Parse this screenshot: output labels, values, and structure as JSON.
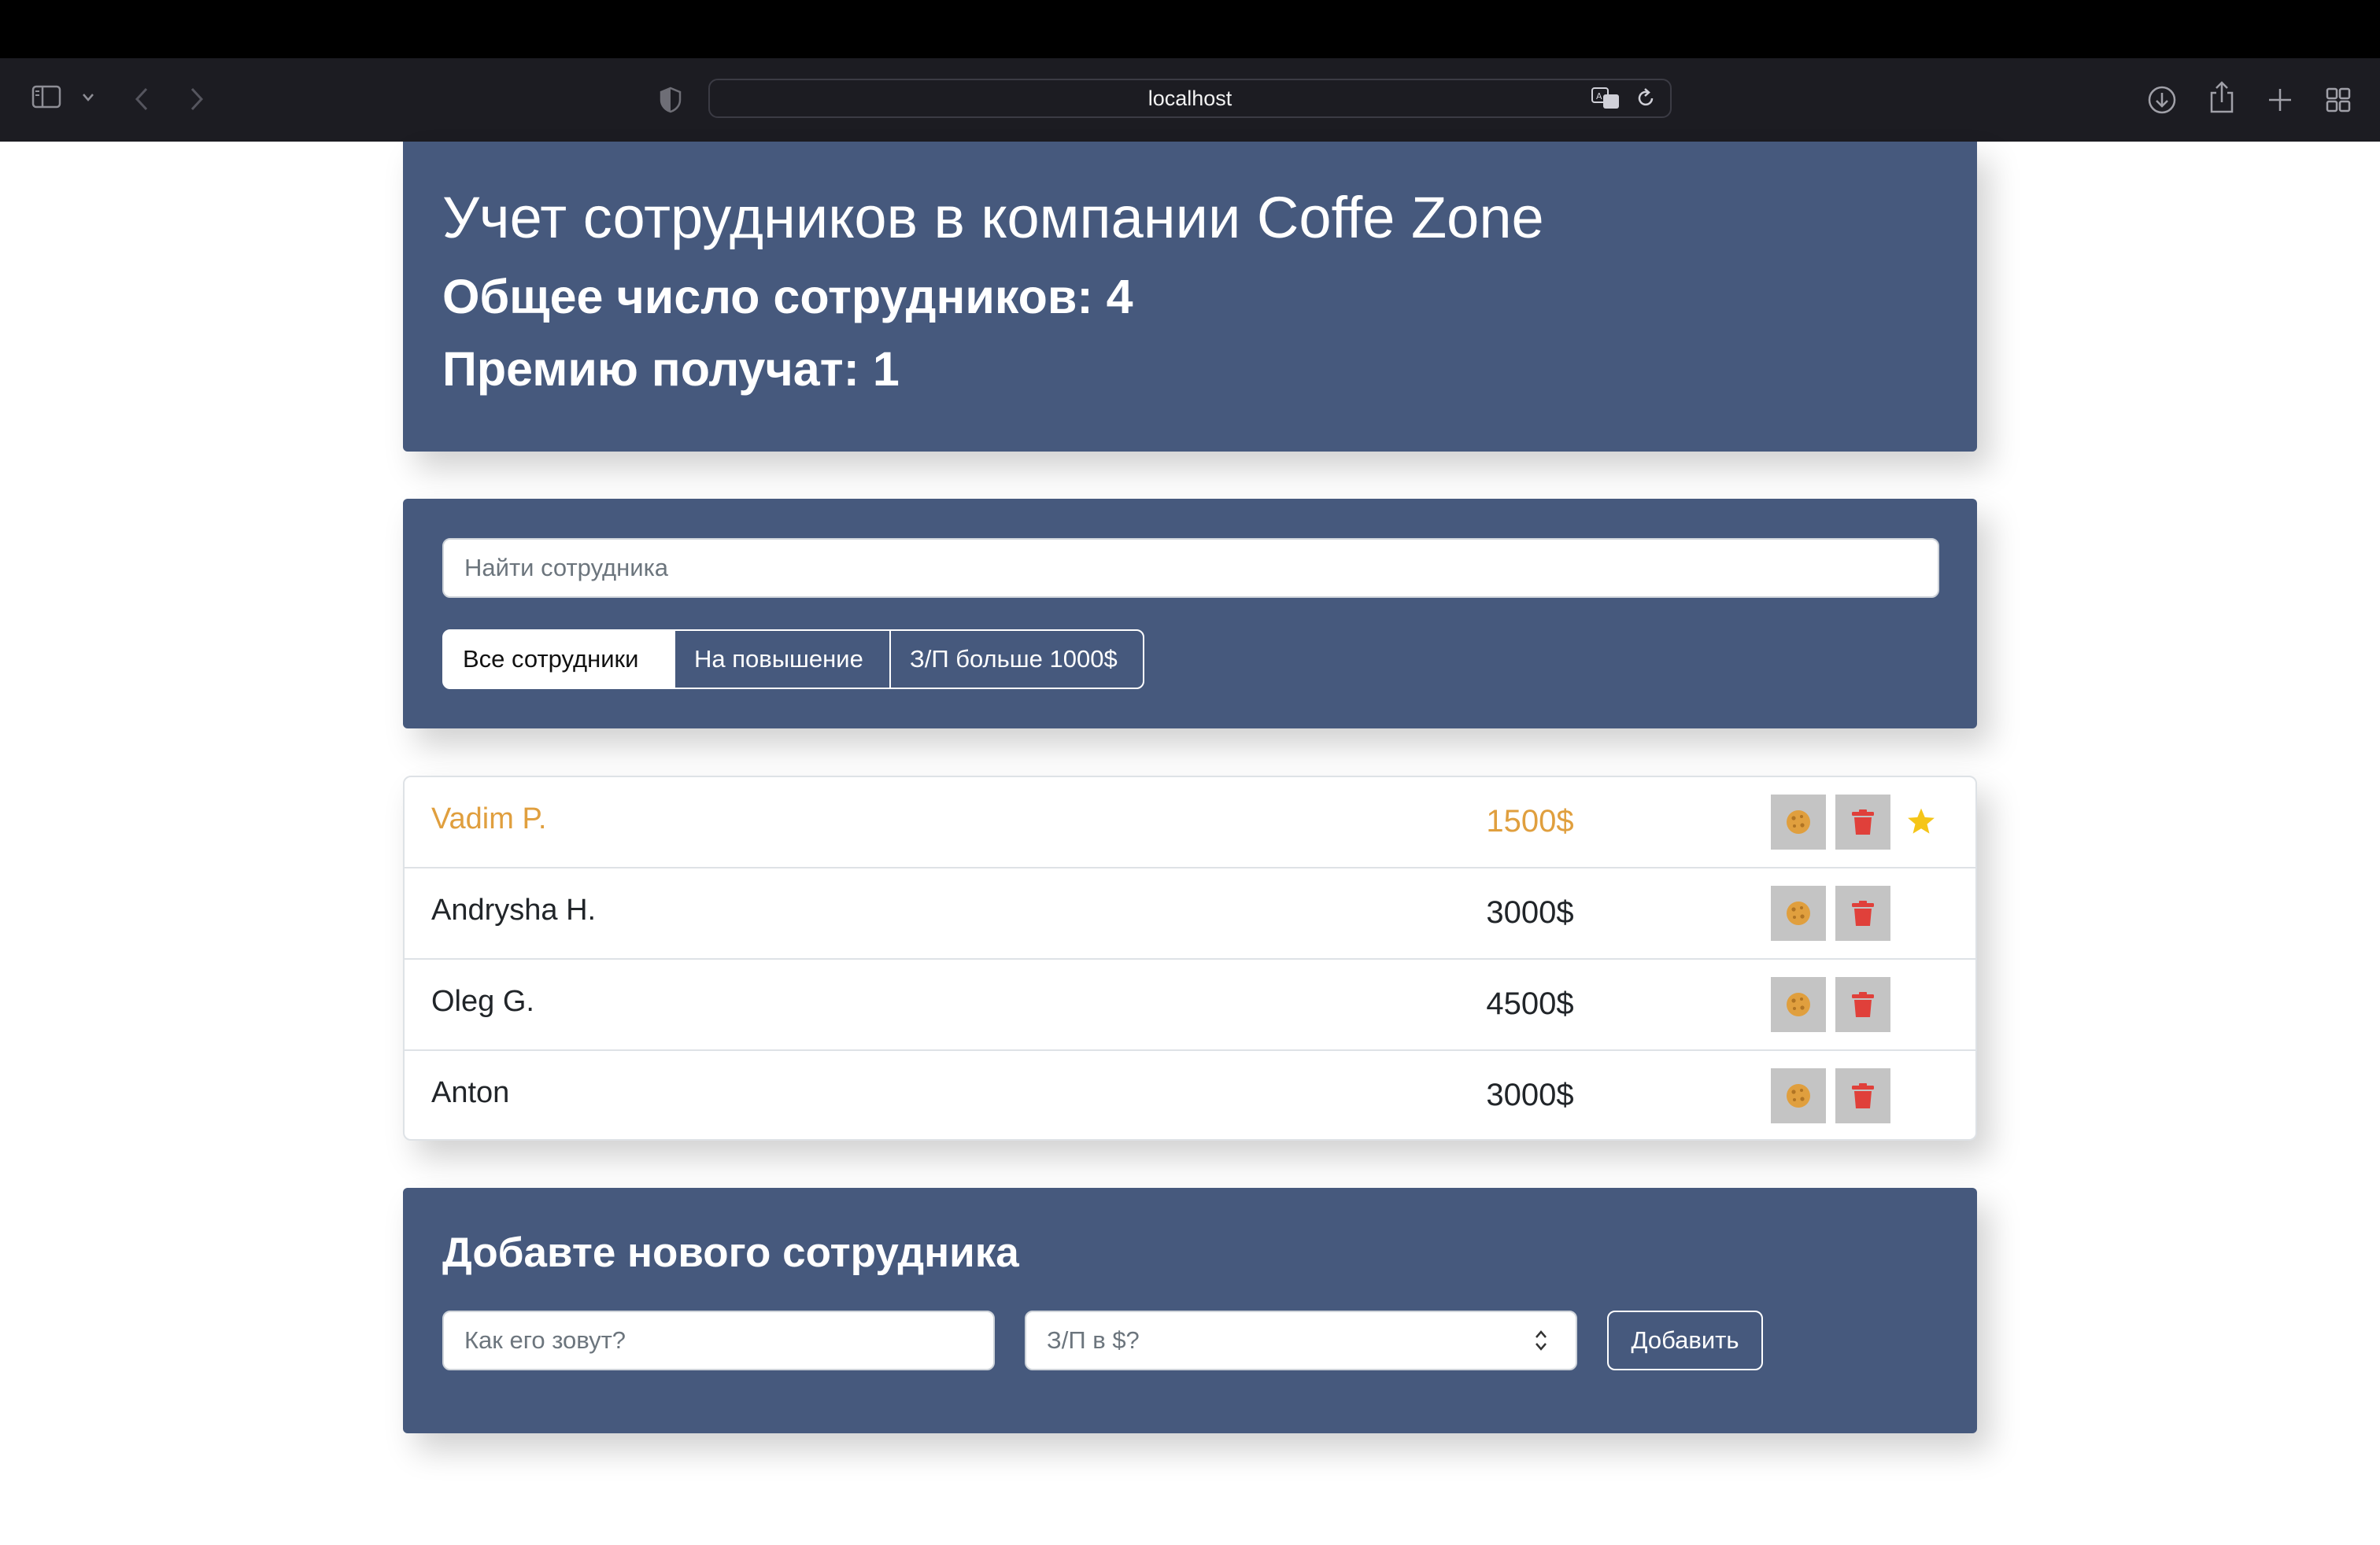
{
  "browser": {
    "url": "localhost"
  },
  "app_info": {
    "title": "Учет сотрудников в компании Coffe Zone",
    "total_label": "Общее число сотрудников: 4",
    "bonus_label": "Премию получат: 1"
  },
  "search": {
    "placeholder": "Найти сотрудника"
  },
  "filters": [
    {
      "label": "Все сотрудники",
      "active": true
    },
    {
      "label": "На повышение",
      "active": false
    },
    {
      "label": "З/П больше 1000$",
      "active": false
    }
  ],
  "employees": [
    {
      "name": "Vadim P.",
      "salary": "1500$",
      "increase": true,
      "starred": true
    },
    {
      "name": "Andrysha H.",
      "salary": "3000$",
      "increase": false,
      "starred": false
    },
    {
      "name": "Oleg G.",
      "salary": "4500$",
      "increase": false,
      "starred": false
    },
    {
      "name": "Anton",
      "salary": "3000$",
      "increase": false,
      "starred": false
    }
  ],
  "add_form": {
    "title": "Добавте нового сотрудника",
    "name_placeholder": "Как его зовут?",
    "salary_placeholder": "З/П в $?",
    "submit_label": "Добавить"
  },
  "colors": {
    "panel": "#46597d",
    "increase": "#e09f3e",
    "danger": "#e0403a",
    "star": "#f5c518"
  },
  "icons": {
    "sidebar": "sidebar-icon",
    "back": "chevron-left-icon",
    "forward": "chevron-right-icon",
    "shield": "shield-icon",
    "translate": "translate-icon",
    "reload": "reload-icon",
    "download": "download-icon",
    "share": "share-icon",
    "new_tab": "plus-icon",
    "tabs": "tab-overview-icon",
    "cookie": "cookie-icon",
    "trash": "trash-icon",
    "star": "star-icon"
  }
}
